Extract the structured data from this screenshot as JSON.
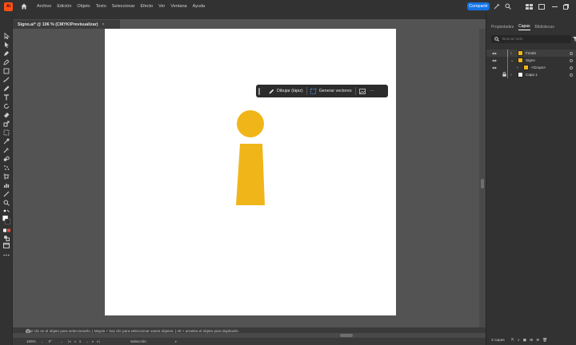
{
  "app": {
    "logo_text": "Ai"
  },
  "menu": [
    "Archivo",
    "Edición",
    "Objeto",
    "Texto",
    "Seleccionar",
    "Efecto",
    "Ver",
    "Ventana",
    "Ayuda"
  ],
  "share_label": "Compartir",
  "document": {
    "tab_title": "Signo.ai* @ 106 % (CMYK/Previsualizar)",
    "close": "×"
  },
  "context_bar": {
    "draw_label": "Dibujar (lápiz)",
    "vector_label": "Generar vectores",
    "more": "···"
  },
  "artwork": {
    "color": "#f0b619",
    "shape": "letter-i"
  },
  "panel": {
    "tabs": [
      "Propiedades",
      "Capas",
      "Bibliotecas"
    ],
    "active_tab": "Capas",
    "search_placeholder": "Buscar todo",
    "layers": [
      {
        "name": "Fondo",
        "color": "#4bbf2f",
        "indent": 0,
        "expand": "›"
      },
      {
        "name": "Signo",
        "color": "#e84a3b",
        "indent": 0,
        "expand": "⌄"
      },
      {
        "name": "<Grupo>",
        "color": "#e84a3b",
        "indent": 1,
        "expand": "›"
      },
      {
        "name": "Capa 1",
        "color": "#3f7fe0",
        "indent": 0,
        "expand": "›"
      }
    ],
    "footer_count": "3 capas"
  },
  "hint": "Haz clic en el objeto para seleccionarlo. | Mayús + haz clic para seleccionar varios objetos. | Alt + arrastra el objeto para duplicarlo.",
  "status": {
    "zoom": "106%",
    "angle": "0°",
    "artboard_num": "1",
    "mode": "Selección"
  }
}
